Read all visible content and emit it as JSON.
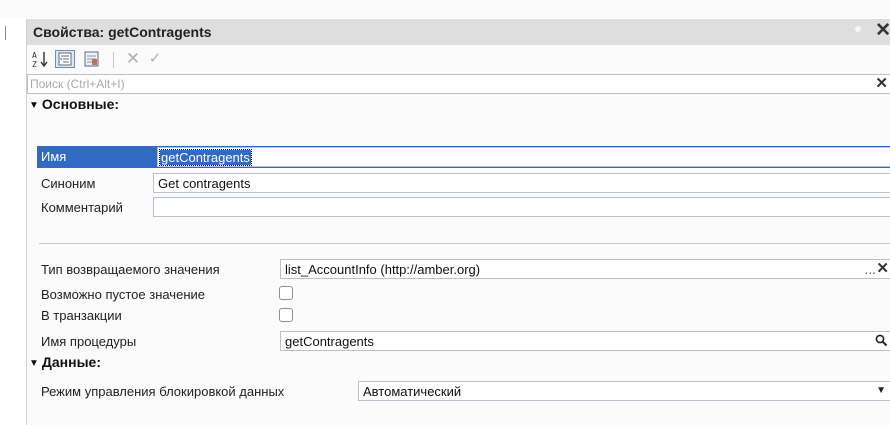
{
  "window": {
    "title": "Свойства: getContragents"
  },
  "toolbar": {
    "sort_icon": "sort-az-icon",
    "categories_icon": "categories-icon",
    "sheet_icon": "property-sheet-icon",
    "delete_glyph": "✕",
    "apply_glyph": "✓"
  },
  "search": {
    "placeholder": "Поиск (Ctrl+Alt+I)",
    "value": ""
  },
  "groups": {
    "main": {
      "label": "Основные:"
    },
    "data": {
      "label": "Данные:"
    }
  },
  "props": {
    "name": {
      "label": "Имя",
      "value": "getContragents"
    },
    "synonym": {
      "label": "Синоним",
      "value": "Get contragents"
    },
    "comment": {
      "label": "Комментарий",
      "value": ""
    },
    "return_type": {
      "label": "Тип возвращаемого значения",
      "value": "list_AccountInfo (http://amber.org)"
    },
    "nullable": {
      "label": "Возможно пустое значение",
      "checked": false
    },
    "transaction": {
      "label": "В транзакции",
      "checked": false
    },
    "procedure": {
      "label": "Имя процедуры",
      "value": "getContragents"
    },
    "lock_mode": {
      "label": "Режим управления блокировкой данных",
      "value": "Автоматический"
    }
  },
  "glyphs": {
    "dots": "...",
    "clear": "✕",
    "expanded": "▼",
    "dropdown": "▼"
  },
  "colors": {
    "selection": "#316ac5",
    "titlebar": "#dedede",
    "panel": "#fbfbfb"
  }
}
